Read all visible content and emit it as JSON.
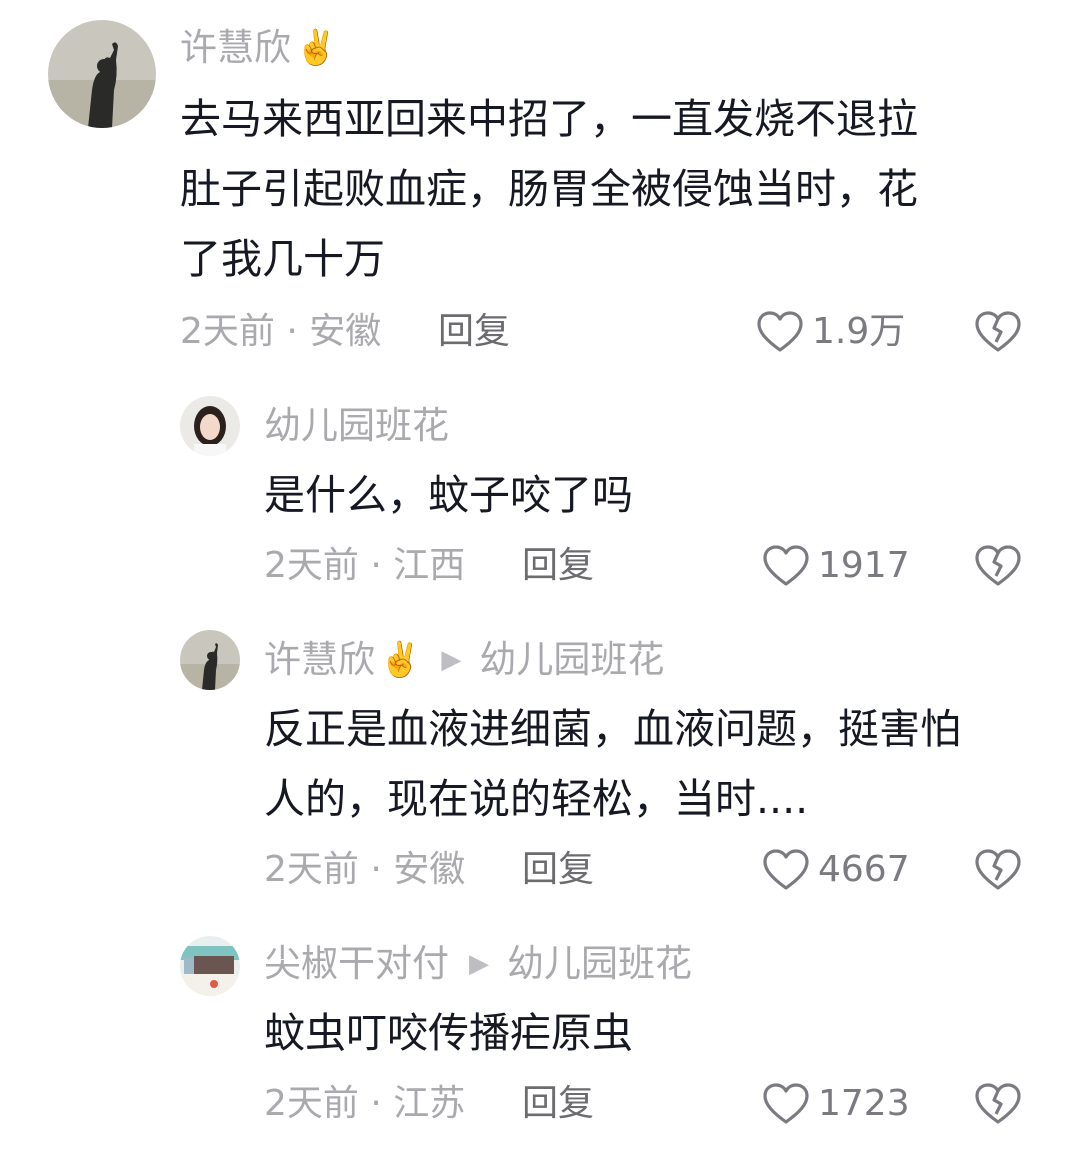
{
  "comments": [
    {
      "user": "许慧欣",
      "emoji": "✌️",
      "reply_to": "",
      "text": "去马来西亚回来中招了，一直发烧不退拉\n肚子引起败血症，肠胃全被侵蚀当时，花\n了我几十万",
      "time": "2天前 · 安徽",
      "reply_label": "回复",
      "likes": "1.9万"
    },
    {
      "user": "幼儿园班花",
      "emoji": "",
      "reply_to": "",
      "text": "是什么，蚊子咬了吗",
      "time": "2天前 · 江西",
      "reply_label": "回复",
      "likes": "1917"
    },
    {
      "user": "许慧欣",
      "emoji": "✌️",
      "reply_to": "幼儿园班花",
      "text": "反正是血液进细菌，血液问题，挺害怕\n人的，现在说的轻松，当时....",
      "time": "2天前 · 安徽",
      "reply_label": "回复",
      "likes": "4667"
    },
    {
      "user": "尖椒干对付",
      "emoji": "",
      "reply_to": "幼儿园班花",
      "text": "蚊虫叮咬传播疟原虫",
      "time": "2天前 · 江苏",
      "reply_label": "回复",
      "likes": "1723"
    }
  ],
  "icons": {
    "like": "heart-outline-icon",
    "dislike": "broken-heart-icon",
    "reply_arrow": "play-triangle-icon"
  },
  "colors": {
    "name": "#a9a9ae",
    "text": "#161823",
    "icon": "#7a7a80"
  }
}
